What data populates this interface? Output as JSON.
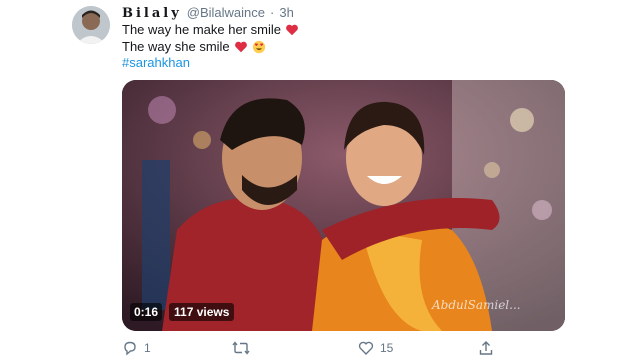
{
  "tweet": {
    "author": {
      "display_name": "Bilaly",
      "handle": "@Bilalwaince",
      "separator": "·",
      "time": "3h"
    },
    "text_line_1": "The way he make her smile",
    "text_line_2": "The way she smile",
    "hashtag": "#sarahkhan",
    "line1_emojis": [
      "red-heart"
    ],
    "line2_emojis": [
      "red-heart",
      "heart-eyes"
    ]
  },
  "media": {
    "duration": "0:16",
    "views": "117 views",
    "watermark": "AbdulSamiel..."
  },
  "actions": {
    "reply_count": "1",
    "retweet_count": "",
    "like_count": "15",
    "share_label": ""
  },
  "colors": {
    "link": "#1b95e0",
    "muted": "#657786",
    "heart": "#e0245e"
  }
}
